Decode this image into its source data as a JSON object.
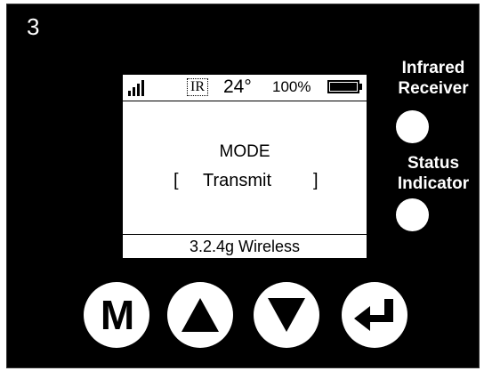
{
  "step_number": "3",
  "side_labels": {
    "infrared_line1": "Infrared",
    "infrared_line2": "Receiver",
    "status_line1": "Status",
    "status_line2": "Indicator"
  },
  "screen": {
    "status_bar": {
      "signal_icon": "signal-bars-icon",
      "ir_label": "IR",
      "temperature": "24°",
      "battery_percent": "100%",
      "battery_level": 1.0
    },
    "mode_label": "MODE",
    "mode_bracket_open": "[",
    "mode_value": "Transmit",
    "mode_bracket_close": "]",
    "footer": "3.2.4g Wireless"
  },
  "buttons": {
    "m_label": "M",
    "up_icon": "up-arrow-icon",
    "down_icon": "down-arrow-icon",
    "enter_icon": "enter-return-icon"
  },
  "colors": {
    "panel": "#000000",
    "foreground": "#ffffff",
    "screen": "#ffffff"
  }
}
